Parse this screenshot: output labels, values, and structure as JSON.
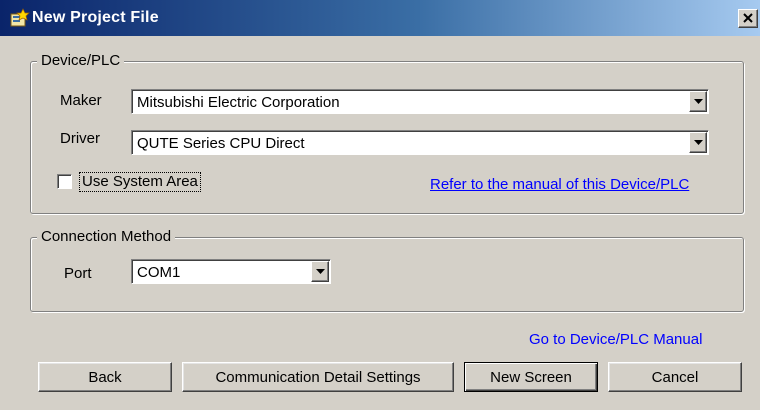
{
  "window": {
    "title": "New Project File"
  },
  "device_plc": {
    "group_label": "Device/PLC",
    "maker_label": "Maker",
    "maker_value": "Mitsubishi Electric Corporation",
    "driver_label": "Driver",
    "driver_value": "QUTE Series CPU Direct",
    "use_system_area_label": "Use System Area",
    "use_system_area_checked": false,
    "manual_link": "Refer to the manual of this Device/PLC"
  },
  "connection": {
    "group_label": "Connection Method",
    "port_label": "Port",
    "port_value": "COM1"
  },
  "footer": {
    "manual_link": "Go to Device/PLC Manual",
    "back_label": "Back",
    "comm_settings_label": "Communication Detail Settings",
    "new_screen_label": "New Screen",
    "cancel_label": "Cancel"
  },
  "icons": {
    "app": "project-file-icon",
    "close": "close-icon",
    "dropdown": "chevron-down-icon"
  }
}
